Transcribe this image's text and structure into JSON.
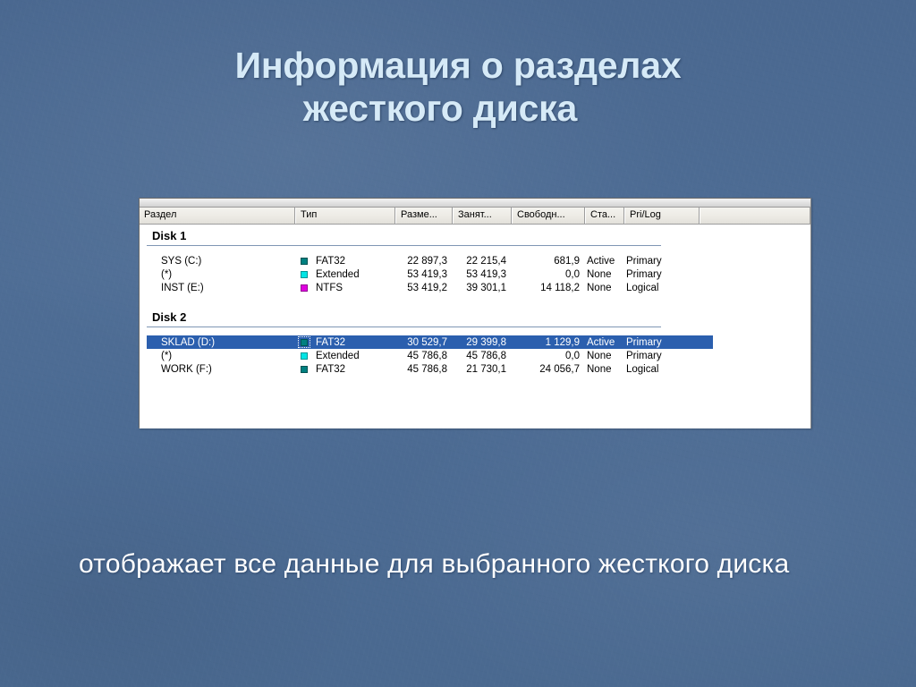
{
  "slide": {
    "title_line1": "Информация о разделах",
    "title_line2": "жесткого диска",
    "caption": "отображает все данные для выбранного жесткого диска",
    "background_color": "#4d6d95",
    "title_color": "#d6eaf7",
    "caption_color": "#ffffff"
  },
  "window": {
    "columns": [
      {
        "key": "razdel",
        "label": "Раздел"
      },
      {
        "key": "tip",
        "label": "Тип"
      },
      {
        "key": "razmer",
        "label": "Разме..."
      },
      {
        "key": "zanyat",
        "label": "Занят..."
      },
      {
        "key": "svobodn",
        "label": "Свободн..."
      },
      {
        "key": "sta",
        "label": "Ста..."
      },
      {
        "key": "prilog",
        "label": "Pri/Log"
      },
      {
        "key": "empty",
        "label": ""
      }
    ],
    "selection_color": "#2b5fae",
    "groups": [
      {
        "name": "Disk 1",
        "rows": [
          {
            "partition": "SYS (C:)",
            "type": "FAT32",
            "type_color": "#008080",
            "size": "22 897,3",
            "used": "22 215,4",
            "free": "681,9",
            "status": "Active",
            "prilog": "Primary",
            "selected": false,
            "focused": false
          },
          {
            "partition": "(*)",
            "type": "Extended",
            "type_color": "#00e5e5",
            "size": "53 419,3",
            "used": "53 419,3",
            "free": "0,0",
            "status": "None",
            "prilog": "Primary",
            "selected": false,
            "focused": false
          },
          {
            "partition": "INST (E:)",
            "type": "NTFS",
            "type_color": "#e000e0",
            "size": "53 419,2",
            "used": "39 301,1",
            "free": "14 118,2",
            "status": "None",
            "prilog": "Logical",
            "selected": false,
            "focused": false
          }
        ]
      },
      {
        "name": "Disk 2",
        "rows": [
          {
            "partition": "SKLAD (D:)",
            "type": "FAT32",
            "type_color": "#008080",
            "size": "30 529,7",
            "used": "29 399,8",
            "free": "1 129,9",
            "status": "Active",
            "prilog": "Primary",
            "selected": true,
            "focused": true
          },
          {
            "partition": "(*)",
            "type": "Extended",
            "type_color": "#00e5e5",
            "size": "45 786,8",
            "used": "45 786,8",
            "free": "0,0",
            "status": "None",
            "prilog": "Primary",
            "selected": false,
            "focused": false
          },
          {
            "partition": "WORK (F:)",
            "type": "FAT32",
            "type_color": "#008080",
            "size": "45 786,8",
            "used": "21 730,1",
            "free": "24 056,7",
            "status": "None",
            "prilog": "Logical",
            "selected": false,
            "focused": false
          }
        ]
      }
    ]
  }
}
